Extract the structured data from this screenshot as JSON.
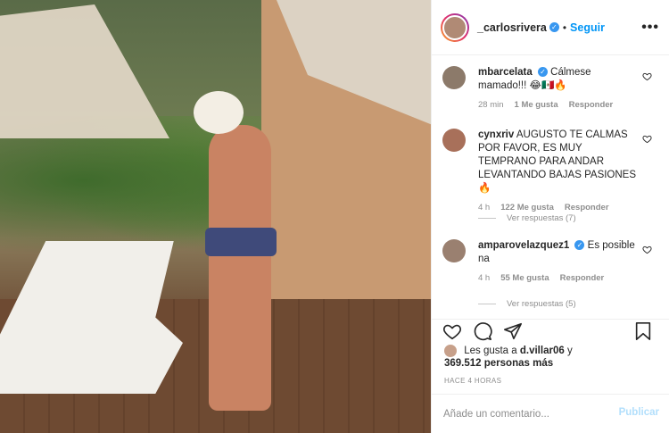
{
  "post": {
    "author": "_carlosrivera",
    "follow_label": "Seguir",
    "separator": "•",
    "more_label": "•••"
  },
  "comments": [
    {
      "username": "mbarcelata",
      "verified": true,
      "text": "Cálmese mamado!!! 😂🇲🇽🔥",
      "time": "28 min",
      "likes": "1 Me gusta",
      "reply_label": "Responder"
    },
    {
      "username": "cynxriv",
      "verified": false,
      "text": "AUGUSTO TE CALMAS POR FAVOR, ES MUY TEMPRANO PARA ANDAR LEVANTANDO BAJAS PASIONES 🔥",
      "time": "4 h",
      "likes": "122 Me gusta",
      "reply_label": "Responder",
      "view_replies": "Ver respuestas (7)"
    },
    {
      "username": "amparovelazquez1",
      "verified": true,
      "text": "Es posible na",
      "time": "4 h",
      "likes": "55 Me gusta",
      "reply_label": "Responder",
      "view_replies": "Ver respuestas (5)"
    }
  ],
  "likes": {
    "prefix": "Les gusta a",
    "user": "d.villar06",
    "joiner": "y",
    "count": "369.512 personas más"
  },
  "timestamp": "HACE 4 HORAS",
  "composer": {
    "placeholder": "Añade un comentario...",
    "publish_label": "Publicar"
  },
  "icons": [
    "heart-icon",
    "comment-icon",
    "share-icon",
    "bookmark-icon",
    "more-icon",
    "verified-icon"
  ],
  "colors": {
    "accent": "#0095f6",
    "publish_disabled": "#b2dffc",
    "verified": "#3897f0",
    "meta": "#8e8e8e"
  }
}
